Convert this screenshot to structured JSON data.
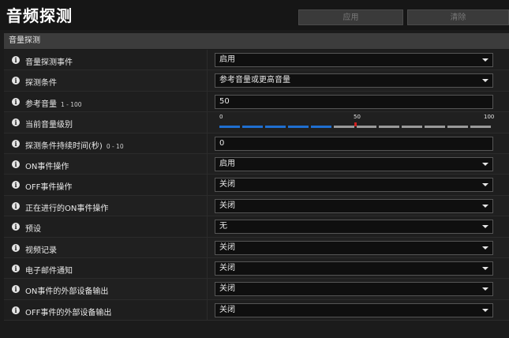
{
  "header": {
    "title": "音频探测",
    "apply_label": "应用",
    "clear_label": "清除"
  },
  "section": {
    "title": "音量探测"
  },
  "rows": [
    {
      "label": "音量探测事件",
      "range": "",
      "type": "select",
      "value": "启用"
    },
    {
      "label": "探测条件",
      "range": "",
      "type": "select",
      "value": "参考音量或更高音量"
    },
    {
      "label": "参考音量",
      "range": "1 - 100",
      "type": "input",
      "value": "50"
    },
    {
      "label": "当前音量级别",
      "range": "",
      "type": "meter"
    },
    {
      "label": "探测条件持续时间(秒)",
      "range": "0 - 10",
      "type": "input",
      "value": "0"
    },
    {
      "label": "ON事件操作",
      "range": "",
      "type": "select",
      "value": "启用"
    },
    {
      "label": "OFF事件操作",
      "range": "",
      "type": "select",
      "value": "关闭"
    },
    {
      "label": "正在进行的ON事件操作",
      "range": "",
      "type": "select",
      "value": "关闭"
    },
    {
      "label": "预设",
      "range": "",
      "type": "select",
      "value": "无"
    },
    {
      "label": "视频记录",
      "range": "",
      "type": "select",
      "value": "关闭"
    },
    {
      "label": "电子邮件通知",
      "range": "",
      "type": "select",
      "value": "关闭"
    },
    {
      "label": "ON事件的外部设备输出",
      "range": "",
      "type": "select",
      "value": "关闭"
    },
    {
      "label": "OFF事件的外部设备输出",
      "range": "",
      "type": "select",
      "value": "关闭"
    }
  ],
  "meter": {
    "ticks": [
      "0",
      "50",
      "100"
    ],
    "min": 0,
    "max": 100,
    "segments": 12,
    "active_segments": 5,
    "reference_level": 50,
    "colors": {
      "active": "#1f6fd0",
      "inactive": "#9a9a9a",
      "marker": "#d02020"
    }
  },
  "icons": {
    "info": "info-icon",
    "dropdown": "chevron-down-icon"
  }
}
